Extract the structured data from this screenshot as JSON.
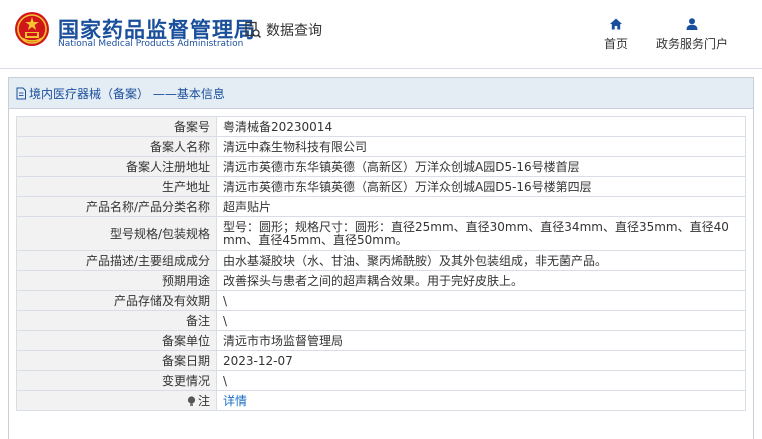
{
  "header": {
    "site_name": "国家药品监督管理局",
    "site_name_en": "National Medical Products Administration",
    "query_label": "数据查询",
    "nav": [
      {
        "label": "首页",
        "icon": "home-icon"
      },
      {
        "label": "政务服务门户",
        "icon": "user-icon"
      }
    ]
  },
  "panel": {
    "title": "境内医疗器械（备案） ——基本信息"
  },
  "rows": [
    {
      "label": "备案号",
      "value": "粤清械备20230014"
    },
    {
      "label": "备案人名称",
      "value": "清远中森生物科技有限公司"
    },
    {
      "label": "备案人注册地址",
      "value": "清远市英德市东华镇英德（高新区）万洋众创城A园D5-16号楼首层"
    },
    {
      "label": "生产地址",
      "value": "清远市英德市东华镇英德（高新区）万洋众创城A园D5-16号楼第四层"
    },
    {
      "label": "产品名称/产品分类名称",
      "value": "超声贴片"
    },
    {
      "label": "型号规格/包装规格",
      "value": "型号：圆形；规格尺寸：圆形：直径25mm、直径30mm、直径34mm、直径35mm、直径40mm、直径45mm、直径50mm。"
    },
    {
      "label": "产品描述/主要组成成分",
      "value": "由水基凝胶块（水、甘油、聚丙烯酰胺）及其外包装组成，非无菌产品。"
    },
    {
      "label": "预期用途",
      "value": "改善探头与患者之间的超声耦合效果。用于完好皮肤上。"
    },
    {
      "label": "产品存储及有效期",
      "value": "\\"
    },
    {
      "label": "备注",
      "value": "\\"
    },
    {
      "label": "备案单位",
      "value": "清远市市场监督管理局"
    },
    {
      "label": "备案日期",
      "value": "2023-12-07"
    },
    {
      "label": "变更情况",
      "value": "\\"
    },
    {
      "label": "注",
      "value": "详情",
      "icon": "lightbulb-icon"
    }
  ],
  "colors": {
    "brand": "#1a4f9c",
    "panel_header": "#e4ecf4",
    "label_bg": "#f2f2f2",
    "link": "#1a6ec6",
    "emblem_red": "#d0161b",
    "emblem_gold": "#f4c430"
  }
}
